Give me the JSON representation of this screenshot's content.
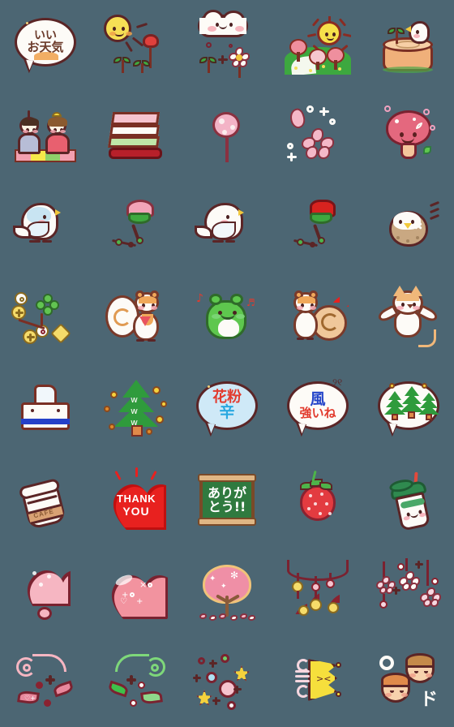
{
  "page": {
    "title": "Sticker / Emoji Sheet",
    "background_color": "#4c6673",
    "grid": {
      "columns": 5,
      "rows": 8,
      "cell_size_px": 112,
      "total_items": 40
    }
  },
  "palette": {
    "background": "#4c6673",
    "outline_dark": "#5b2526",
    "outline_brown": "#7a2f24",
    "paper_white": "#fdfbf7",
    "sakura_pink": "#f4b8c8",
    "deep_pink": "#e4687e",
    "red": "#e33b40",
    "green": "#3da83f",
    "leaf_green": "#5ec74e",
    "yellow": "#f6df55",
    "sky_blue": "#cfe9f7",
    "chalk_green": "#2f7a3f",
    "blue_text": "#2445c9",
    "cyan_text": "#2aa8e0",
    "tan": "#c9a882",
    "gold": "#f6dc6a"
  },
  "items": [
    {
      "id": "r1c1",
      "row": 1,
      "col": 1,
      "name": "speech-bubble-nice-weather",
      "label": "Speech bubble: nice weather",
      "text_lines": [
        "いい",
        "お天気"
      ],
      "text_color": "#6b3a2a",
      "bubble_color": "#fdfbf7"
    },
    {
      "id": "r1c2",
      "row": 1,
      "col": 2,
      "name": "smiling-sun-with-tulip-and-sprouts",
      "label": "Smiling sun with tulip and sprouts",
      "text_lines": []
    },
    {
      "id": "r1c3",
      "row": 1,
      "col": 3,
      "name": "smiling-cloud-with-flower-and-sprouts",
      "label": "Smiling cloud with flower and sprouts",
      "text_lines": []
    },
    {
      "id": "r1c4",
      "row": 1,
      "col": 4,
      "name": "spring-hill-landscape-with-sun",
      "label": "Spring hill landscape with sun and cherry trees",
      "text_lines": []
    },
    {
      "id": "r1c5",
      "row": 1,
      "col": 5,
      "name": "white-bird-on-tree-stump",
      "label": "White bird perched on a tree stump",
      "text_lines": []
    },
    {
      "id": "r2c1",
      "row": 2,
      "col": 1,
      "name": "hina-dolls-pair",
      "label": "Hina Matsuri doll pair on a mat",
      "text_lines": []
    },
    {
      "id": "r2c2",
      "row": 2,
      "col": 2,
      "name": "hishimochi-layered-rice-cake",
      "label": "Hishimochi layered rice cake",
      "text_lines": []
    },
    {
      "id": "r2c3",
      "row": 2,
      "col": 3,
      "name": "pink-flower-pompom",
      "label": "Pink flower pompom on a stem",
      "text_lines": []
    },
    {
      "id": "r2c4",
      "row": 2,
      "col": 4,
      "name": "sakura-petals-sparkles",
      "label": "Cherry blossom petals with sparkles",
      "text_lines": []
    },
    {
      "id": "r2c5",
      "row": 2,
      "col": 5,
      "name": "smiling-pink-mushroom",
      "label": "Smiling pink mushroom with hearts",
      "text_lines": []
    },
    {
      "id": "r3c1",
      "row": 3,
      "col": 1,
      "name": "blue-budgie-bird",
      "label": "Blue and white budgie bird",
      "text_lines": []
    },
    {
      "id": "r3c2",
      "row": 3,
      "col": 2,
      "name": "pink-flower-branch",
      "label": "Pink flower on a branch",
      "text_lines": []
    },
    {
      "id": "r3c3",
      "row": 3,
      "col": 3,
      "name": "white-bird",
      "label": "White bird",
      "text_lines": []
    },
    {
      "id": "r3c4",
      "row": 3,
      "col": 4,
      "name": "red-flower-branch",
      "label": "Red flower on a branch",
      "text_lines": []
    },
    {
      "id": "r3c5",
      "row": 3,
      "col": 5,
      "name": "brown-sparrow",
      "label": "Round brown sparrow",
      "text_lines": []
    },
    {
      "id": "r4c1",
      "row": 4,
      "col": 1,
      "name": "clover-with-gold-sparkles",
      "label": "Green clover with gold coins and sparkles",
      "text_lines": []
    },
    {
      "id": "r4c2",
      "row": 4,
      "col": 2,
      "name": "sitting-squirrel",
      "label": "Sitting squirrel",
      "text_lines": []
    },
    {
      "id": "r4c3",
      "row": 4,
      "col": 3,
      "name": "singing-green-frog",
      "label": "Green frog with music notes",
      "text_lines": []
    },
    {
      "id": "r4c4",
      "row": 4,
      "col": 4,
      "name": "squirrel-with-hearts",
      "label": "Squirrel with hearts",
      "text_lines": []
    },
    {
      "id": "r4c5",
      "row": 4,
      "col": 5,
      "name": "cheering-cat",
      "label": "Cat with arms raised",
      "text_lines": []
    },
    {
      "id": "r5c1",
      "row": 5,
      "col": 1,
      "name": "tissue-box",
      "label": "Tissue box with blue stripe",
      "text_lines": []
    },
    {
      "id": "r5c2",
      "row": 5,
      "col": 2,
      "name": "cedar-tree-pollen",
      "label": "Cedar tree releasing pollen",
      "text_lines": []
    },
    {
      "id": "r5c3",
      "row": 5,
      "col": 3,
      "name": "speech-bubble-pollen-tough",
      "label": "Speech bubble: pollen is tough",
      "text_lines": [
        "花粉",
        "辛"
      ],
      "text_color_line1": "#e23b2e",
      "text_color_line2": "#2aa8e0",
      "bubble_color": "#cfe9f7"
    },
    {
      "id": "r5c4",
      "row": 5,
      "col": 4,
      "name": "speech-bubble-strong-wind",
      "label": "Speech bubble: the wind is strong",
      "text_lines": [
        "風",
        "強いね"
      ],
      "text_color_line1": "#2445c9",
      "text_color_line2": "#e23b2e",
      "bubble_color": "#fdfbf7"
    },
    {
      "id": "r5c5",
      "row": 5,
      "col": 5,
      "name": "cedar-forest-bubble",
      "label": "Speech bubble with cedar forest",
      "text_lines": []
    },
    {
      "id": "r6c1",
      "row": 6,
      "col": 1,
      "name": "cafe-takeaway-cup",
      "label": "Takeaway coffee cup",
      "text_lines": [
        "CAFE"
      ],
      "text_color": "#8a5a34"
    },
    {
      "id": "r6c2",
      "row": 6,
      "col": 2,
      "name": "thank-you-heart",
      "label": "Red heart reading THANK YOU",
      "text_lines": [
        "THANK",
        "YOU"
      ],
      "text_color": "#ffffff",
      "shape_color": "#e8211f"
    },
    {
      "id": "r6c3",
      "row": 6,
      "col": 3,
      "name": "chalkboard-arigatou",
      "label": "Chalkboard reading thank you",
      "text_lines": [
        "ありが",
        "とう!!"
      ],
      "text_color": "#ffffff",
      "board_color": "#2f7a3f"
    },
    {
      "id": "r6c4",
      "row": 6,
      "col": 4,
      "name": "strawberry",
      "label": "Strawberry",
      "text_lines": []
    },
    {
      "id": "r6c5",
      "row": 6,
      "col": 5,
      "name": "green-tea-frappuccino",
      "label": "Green tea frappuccino cup with face",
      "text_lines": []
    },
    {
      "id": "r7c1",
      "row": 7,
      "col": 1,
      "name": "pink-heart-exclamation",
      "label": "Pink heart exclamation mark",
      "text_lines": []
    },
    {
      "id": "r7c2",
      "row": 7,
      "col": 2,
      "name": "pink-sparkle-heart",
      "label": "Pink heart with sparkles",
      "text_lines": []
    },
    {
      "id": "r7c3",
      "row": 7,
      "col": 3,
      "name": "cherry-blossom-tree",
      "label": "Cherry blossom tree in full bloom",
      "text_lines": []
    },
    {
      "id": "r7c4",
      "row": 7,
      "col": 4,
      "name": "hanging-heart-garland",
      "label": "Hanging garland of hearts and gold balls",
      "text_lines": []
    },
    {
      "id": "r7c5",
      "row": 7,
      "col": 5,
      "name": "hanging-sakura-decoration",
      "label": "Hanging cherry blossom decoration",
      "text_lines": []
    },
    {
      "id": "r8c1",
      "row": 8,
      "col": 1,
      "name": "pink-swirl-vine",
      "label": "Pink swirl vine with leaves",
      "text_lines": []
    },
    {
      "id": "r8c2",
      "row": 8,
      "col": 2,
      "name": "green-swirl-vine",
      "label": "Green swirl vine with leaves",
      "text_lines": []
    },
    {
      "id": "r8c3",
      "row": 8,
      "col": 3,
      "name": "colorful-bubble-sparkles",
      "label": "Colorful bubbles and star sparkles",
      "text_lines": []
    },
    {
      "id": "r8c4",
      "row": 8,
      "col": 4,
      "name": "yellow-crown",
      "label": "Yellow crown with swirl",
      "text_lines": []
    },
    {
      "id": "r8c5",
      "row": 8,
      "col": 5,
      "name": "two-kid-faces",
      "label": "Two children faces",
      "text_lines": []
    }
  ]
}
